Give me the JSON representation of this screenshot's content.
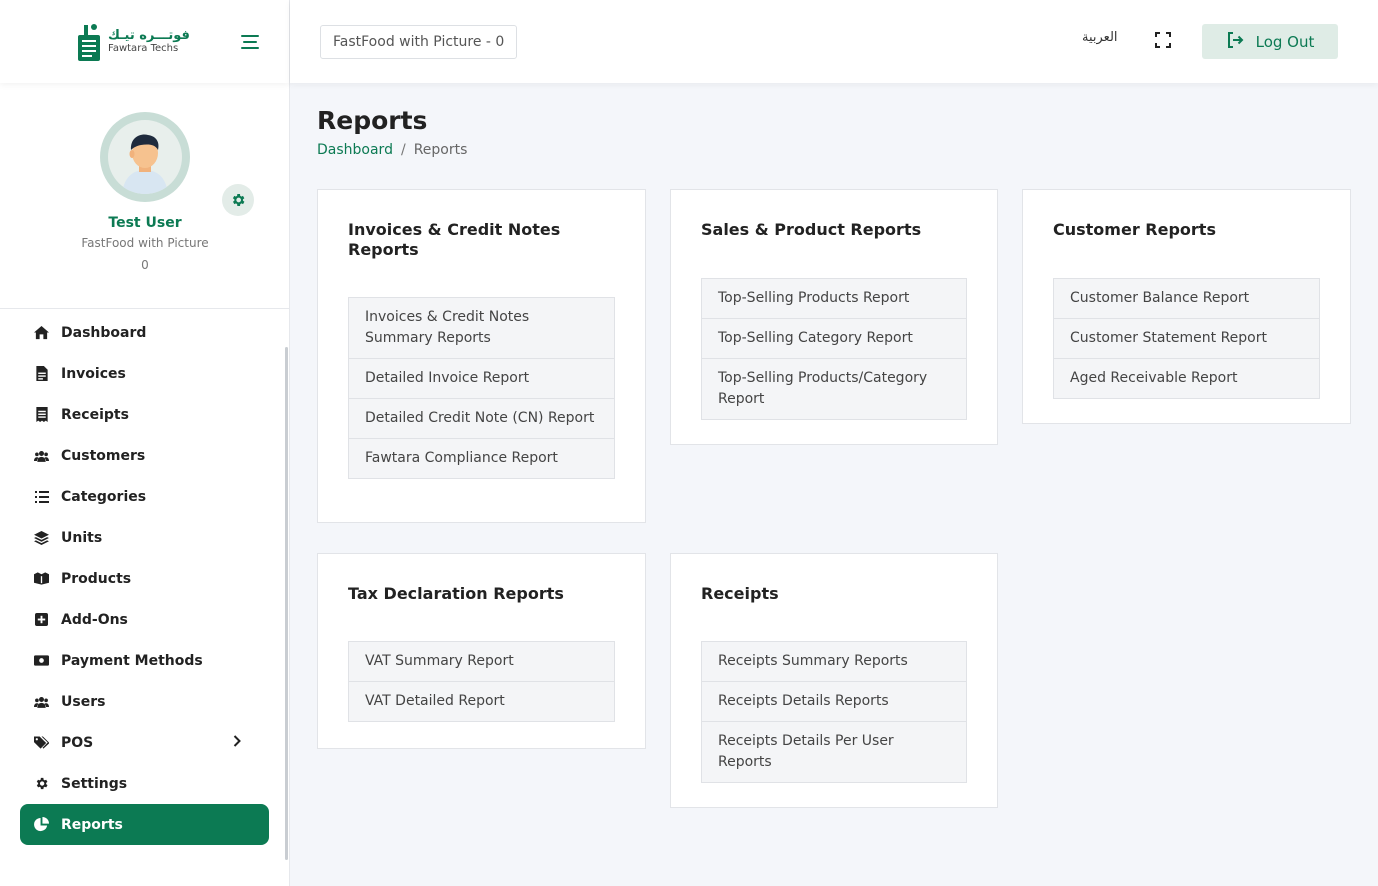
{
  "logo": {
    "arabic": "فوتـــره تيـك",
    "english": "Fawtara Techs"
  },
  "profile": {
    "name": "Test User",
    "company": "FastFood with Picture",
    "id": "0"
  },
  "nav": [
    {
      "label": "Dashboard",
      "icon": "home-icon"
    },
    {
      "label": "Invoices",
      "icon": "file-invoice-icon"
    },
    {
      "label": "Receipts",
      "icon": "receipt-icon"
    },
    {
      "label": "Customers",
      "icon": "users-icon"
    },
    {
      "label": "Categories",
      "icon": "list-icon"
    },
    {
      "label": "Units",
      "icon": "layers-icon"
    },
    {
      "label": "Products",
      "icon": "boxes-icon"
    },
    {
      "label": "Add-Ons",
      "icon": "plus-square-icon"
    },
    {
      "label": "Payment Methods",
      "icon": "money-icon"
    },
    {
      "label": "Users",
      "icon": "users-icon"
    },
    {
      "label": "POS",
      "icon": "tags-icon"
    },
    {
      "label": "Settings",
      "icon": "gear-icon"
    },
    {
      "label": "Reports",
      "icon": "pie-chart-icon"
    }
  ],
  "topbar": {
    "branch": "FastFood with Picture - 0",
    "language": "العربية",
    "logout": "Log Out"
  },
  "page": {
    "title": "Reports",
    "breadcrumb": {
      "home": "Dashboard",
      "separator": "/",
      "current": "Reports"
    }
  },
  "cards": [
    {
      "title": "Invoices & Credit Notes Reports",
      "items": [
        "Invoices & Credit Notes Summary Reports",
        "Detailed Invoice Report",
        "Detailed Credit Note (CN) Report",
        "Fawtara Compliance Report"
      ]
    },
    {
      "title": "Sales & Product Reports",
      "items": [
        "Top-Selling Products Report",
        "Top-Selling Category Report",
        "Top-Selling Products/Category Report"
      ]
    },
    {
      "title": "Customer Reports",
      "items": [
        "Customer Balance Report",
        "Customer Statement Report",
        "Aged Receivable Report"
      ]
    },
    {
      "title": "Tax Declaration Reports",
      "items": [
        "VAT Summary Report",
        "VAT Detailed Report"
      ]
    },
    {
      "title": "Receipts",
      "items": [
        "Receipts Summary Reports",
        "Receipts Details Reports",
        "Receipts Details Per User Reports"
      ]
    }
  ],
  "colors": {
    "brand": "#0c7a53",
    "brand_light": "#dfece6",
    "background": "#f4f6fa"
  }
}
